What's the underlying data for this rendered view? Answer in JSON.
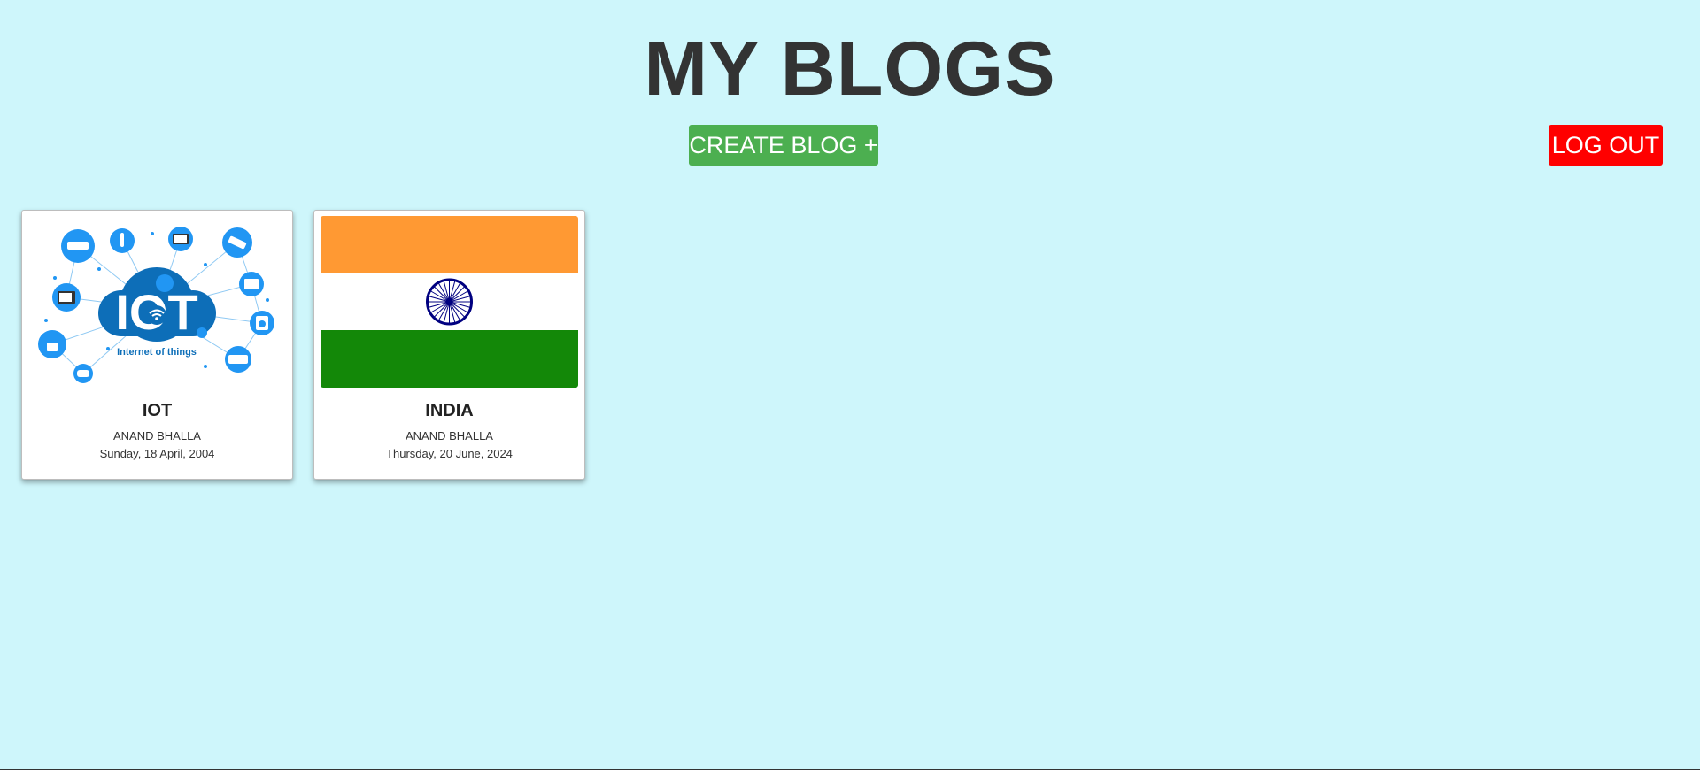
{
  "header": {
    "title": "MY BLOGS"
  },
  "actions": {
    "create_label": "CREATE BLOG +",
    "logout_label": "LOG OUT"
  },
  "blogs": [
    {
      "title": "IOT",
      "author": "ANAND BHALLA",
      "date": "Sunday, 18 April, 2004",
      "image": "iot-illustration",
      "image_caption": "Internet of things"
    },
    {
      "title": "INDIA",
      "author": "ANAND BHALLA",
      "date": "Thursday, 20 June, 2024",
      "image": "india-flag"
    }
  ],
  "colors": {
    "background": "#cef6fb",
    "create_button": "#4caf50",
    "logout_button": "#ff0000",
    "saffron": "#ff9933",
    "green": "#138808",
    "chakra": "#000080",
    "iot_blue": "#2196f3",
    "iot_dark_blue": "#0d6eb8"
  }
}
